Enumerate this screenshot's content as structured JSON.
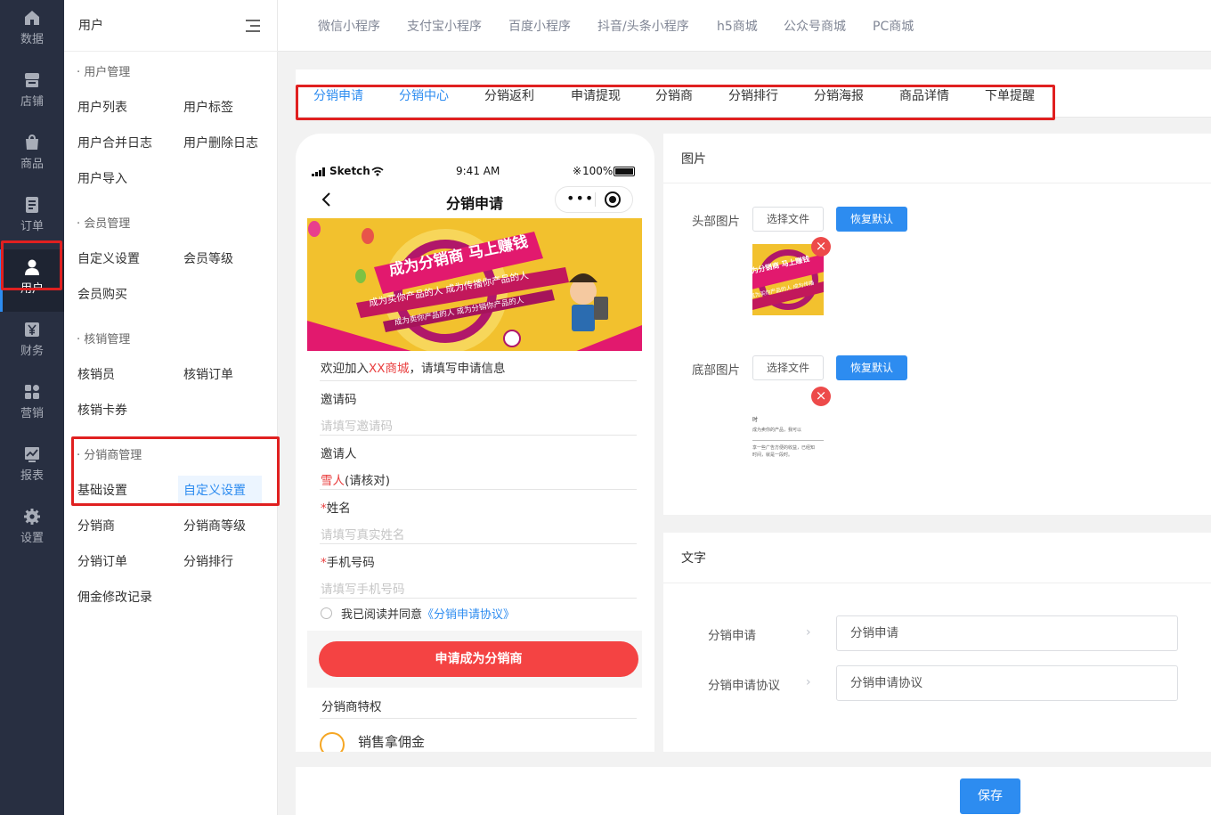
{
  "rail": {
    "items": [
      {
        "label": "数据",
        "icon": "home-icon"
      },
      {
        "label": "店铺",
        "icon": "store-icon"
      },
      {
        "label": "商品",
        "icon": "bag-icon"
      },
      {
        "label": "订单",
        "icon": "order-icon"
      },
      {
        "label": "用户",
        "icon": "user-icon"
      },
      {
        "label": "财务",
        "icon": "yen-icon"
      },
      {
        "label": "营销",
        "icon": "grid-icon"
      },
      {
        "label": "报表",
        "icon": "chart-icon"
      },
      {
        "label": "设置",
        "icon": "gear-icon"
      }
    ]
  },
  "submenu": {
    "title": "用户",
    "sections": [
      {
        "title": "· 用户管理",
        "items": [
          "用户列表",
          "用户标签",
          "用户合并日志",
          "用户删除日志",
          "用户导入"
        ]
      },
      {
        "title": "· 会员管理",
        "items": [
          "自定义设置",
          "会员等级",
          "会员购买"
        ]
      },
      {
        "title": "· 核销管理",
        "items": [
          "核销员",
          "核销订单",
          "核销卡券"
        ]
      },
      {
        "title": "· 分销商管理",
        "items": [
          "基础设置",
          "自定义设置",
          "分销商",
          "分销商等级",
          "分销订单",
          "分销排行",
          "佣金修改记录"
        ]
      }
    ]
  },
  "topnav": [
    "微信小程序",
    "支付宝小程序",
    "百度小程序",
    "抖音/头条小程序",
    "h5商城",
    "公众号商城",
    "PC商城"
  ],
  "tabs": [
    "分销申请",
    "分销中心",
    "分销返利",
    "申请提现",
    "分销商",
    "分销排行",
    "分销海报",
    "商品详情",
    "下单提醒"
  ],
  "phone": {
    "carrier": "Sketch",
    "time": "9:41 AM",
    "battery": "100%",
    "title": "分销申请",
    "banner": {
      "headline": "成为分销商 马上赚钱",
      "line1": "成为买你产品的人 成为传播你产品的人",
      "line2": "成为卖你产品的人 成为分销你产品的人"
    },
    "welcome_prefix": "欢迎加入",
    "welcome_shop": "XX商城",
    "welcome_suffix": "，请填写申请信息",
    "invite_code_label": "邀请码",
    "invite_code_placeholder": "请填写邀请码",
    "inviter_label": "邀请人",
    "inviter_name": "雪人",
    "inviter_note": "(请核对)",
    "name_label": "姓名",
    "name_placeholder": "请填写真实姓名",
    "phone_label": "手机号码",
    "phone_placeholder": "请填写手机号码",
    "agree_prefix": "我已阅读并同意",
    "agree_link": "《分销申请协议》",
    "apply_button": "申请成为分销商",
    "privileges_title": "分销商特权",
    "privilege_1": "销售拿佣金",
    "required_mark": "*"
  },
  "image_card": {
    "title": "图片",
    "header_label": "头部图片",
    "footer_label": "底部图片",
    "choose_file": "选择文件",
    "reset_default": "恢复默认",
    "delete_mark": "×",
    "thumb1_text": "为分销商 马上赚钱",
    "thumb1_sub": "成为买你产品的人 成为传播",
    "thumb2_lines": [
      "时",
      "成为卖你的产品，我可以",
      "享一些广告方便的收益，已经知",
      "时间，就是一段时。"
    ]
  },
  "text_card": {
    "title": "文字",
    "rows": [
      {
        "label": "分销申请",
        "value": "分销申请"
      },
      {
        "label": "分销申请协议",
        "value": "分销申请协议"
      }
    ]
  },
  "footer": {
    "save": "保存"
  },
  "colors": {
    "accent": "#2d8cf0",
    "rail_bg": "#282f41",
    "apply_red": "#f44343",
    "highlight_red": "#e02020",
    "banner_yellow": "#f2c12e"
  }
}
